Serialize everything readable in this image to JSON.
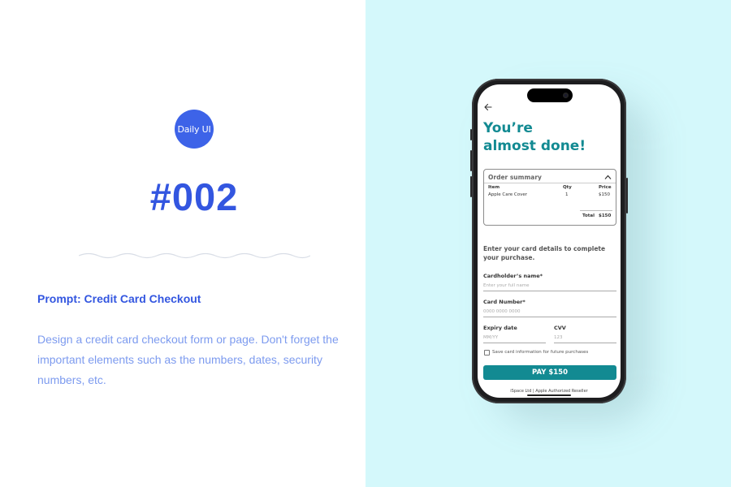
{
  "left": {
    "badge": "Daily UI",
    "number": "#002",
    "prompt_title": "Prompt: Credit Card Checkout",
    "prompt_desc": "Design a credit card checkout form or page. Don't forget the important elements such as the numbers, dates, security numbers, etc."
  },
  "colors": {
    "left_bg": "#ffffff",
    "right_bg": "#d4f8fb",
    "brand_blue": "#3356e0",
    "teal": "#128a92"
  },
  "phone": {
    "heading_line1": "You’re",
    "heading_line2": "almost done!",
    "order_summary": {
      "title": "Order summary",
      "columns": [
        "Item",
        "Qty",
        "Price"
      ],
      "rows": [
        {
          "item": "Apple Care Cover",
          "qty": "1",
          "price": "$150"
        }
      ],
      "total_label": "Total",
      "total_value": "$150"
    },
    "instruction": "Enter your card details to complete your purchase.",
    "fields": {
      "name_label": "Cardholder’s name*",
      "name_placeholder": "Enter your full name",
      "number_label": "Card Number*",
      "number_placeholder": "0000 0000 0000",
      "expiry_label": "Expiry date",
      "expiry_placeholder": "MM/YY",
      "cvv_label": "CVV",
      "cvv_placeholder": "123"
    },
    "save_card_label": "Save card information for future purchases",
    "pay_button": "PAY $150",
    "footer": "iSpace Ltd | Apple Authorized Reseller"
  }
}
